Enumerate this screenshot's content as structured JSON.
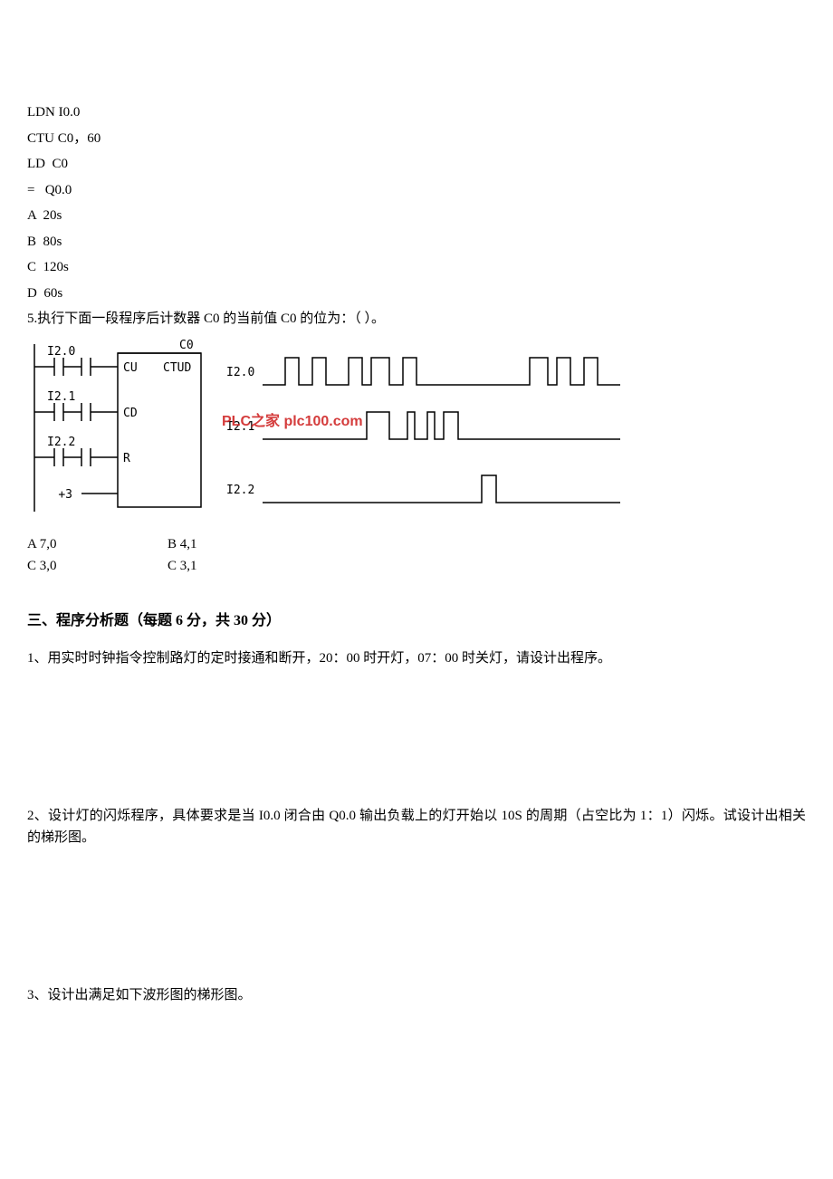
{
  "code": {
    "l1": "LDN I0.0",
    "l2": "CTU C0，60",
    "l3": "LD  C0",
    "l4": "=   Q0.0",
    "l5": "A  20s",
    "l6": "B  80s",
    "l7": "C  120s",
    "l8": "D  60s"
  },
  "q5": "5.执行下面一段程序后计数器 C0 的当前值 C0 的位为：（          ）。",
  "diagram": {
    "c0": "C0",
    "i20": "I2.0",
    "i21": "I2.1",
    "i22": "I2.2",
    "cu": "CU",
    "cd": "CD",
    "r": "R",
    "ctud": "CTUD",
    "preset": "+3",
    "sig_i20": "I2.0",
    "sig_i21": "I2.1",
    "sig_i22": "I2.2",
    "watermark": "PLC之家 plc100.com"
  },
  "answers": {
    "r1c1": "A  7,0",
    "r1c2": "B  4,1",
    "r2c1": "C  3,0",
    "r2c2": "C  3,1"
  },
  "section3_title": "三、程序分析题（每题 6 分，共 30 分）",
  "q3_1": "1、用实时时钟指令控制路灯的定时接通和断开，20：00 时开灯，07：00 时关灯，请设计出程序。",
  "q3_2": "2、设计灯的闪烁程序，具体要求是当 I0.0 闭合由 Q0.0 输出负载上的灯开始以 10S 的周期（占空比为 1：1）闪烁。试设计出相关的梯形图。",
  "q3_3": "3、设计出满足如下波形图的梯形图。"
}
